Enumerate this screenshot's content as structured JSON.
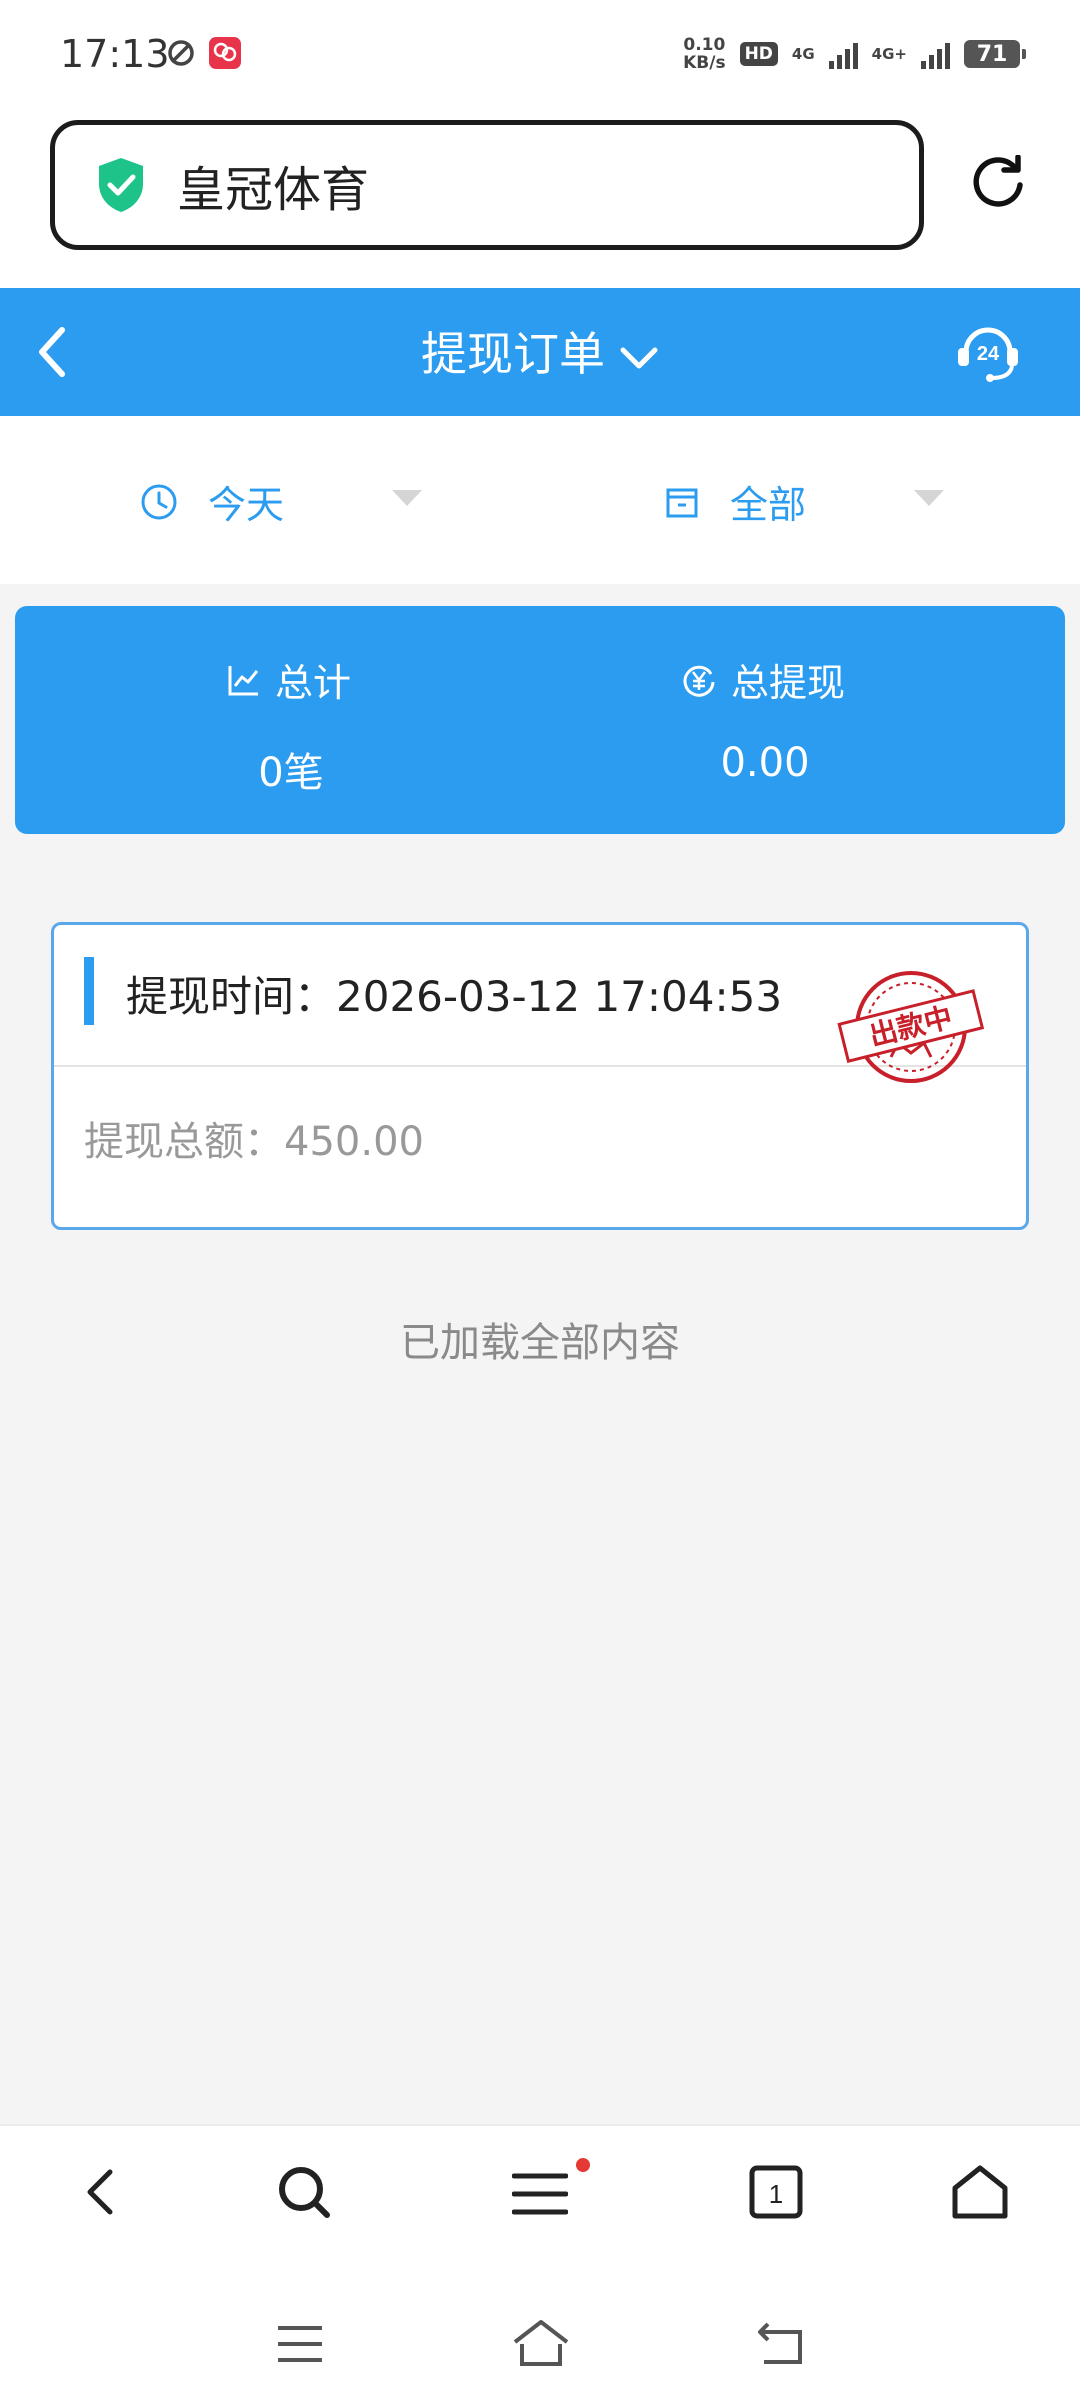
{
  "status_bar": {
    "time": "17:13",
    "net_speed_value": "0.10",
    "net_speed_unit": "KB/s",
    "hd_label": "HD",
    "sim1_net": "4G",
    "sim2_net": "4G+",
    "battery": "71"
  },
  "address_bar": {
    "site_name": "皇冠体育",
    "secure_icon": "shield-check-icon",
    "reload_icon": "reload-icon"
  },
  "header": {
    "title": "提现订单",
    "support_badge": "24"
  },
  "filters": {
    "date_label": "今天",
    "status_label": "全部"
  },
  "summary": {
    "count_label": "总计",
    "count_value": "0笔",
    "amount_label": "总提现",
    "amount_value": "0.00"
  },
  "orders": [
    {
      "time_label": "提现时间：",
      "time_value": "2026-03-12 17:04:53",
      "amount_label": "提现总额：",
      "amount_value": "450.00",
      "stamp_text": "出款中"
    }
  ],
  "footer_text": "已加载全部内容",
  "toolbar": {
    "tab_count": "1"
  },
  "colors": {
    "accent": "#2b9cf0",
    "stamp": "#c8202a",
    "secure": "#1ec38a"
  }
}
